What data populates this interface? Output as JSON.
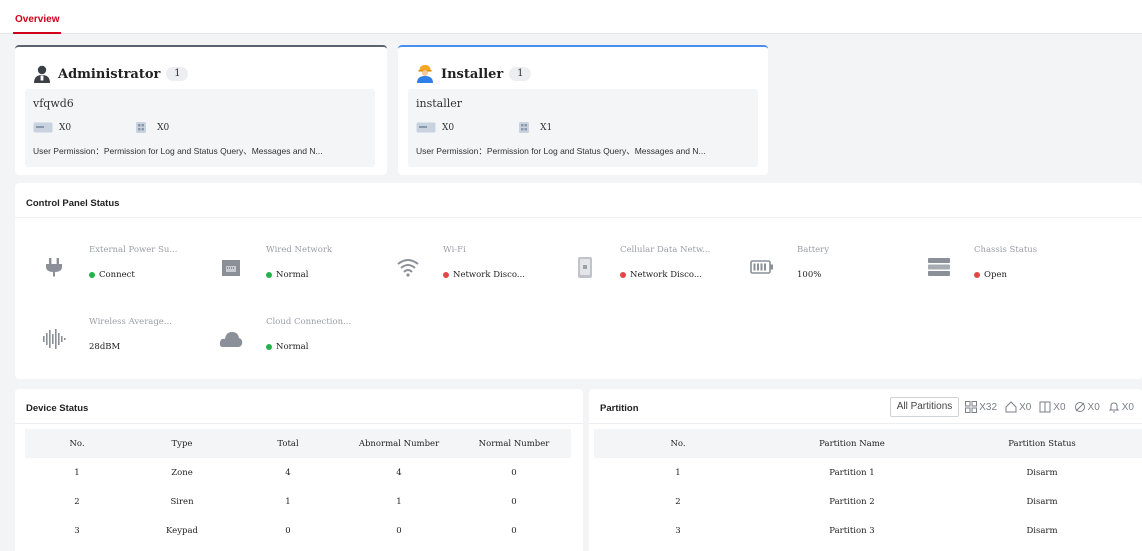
{
  "tabs": [
    {
      "label": "Overview",
      "active": true
    }
  ],
  "users": [
    {
      "role": "Administrator",
      "count": "1",
      "username": "vfqwd6",
      "card_count": "X0",
      "tag_count": "X0",
      "permission": "User Permission：Permission for Log and Status Query、Messages and N...",
      "icon": "admin-avatar-icon"
    },
    {
      "role": "Installer",
      "count": "1",
      "username": "installer",
      "card_count": "X0",
      "tag_count": "X1",
      "permission": "User Permission：Permission for Log and Status Query、Messages and N...",
      "icon": "installer-avatar-icon"
    }
  ],
  "control_panel": {
    "title": "Control Panel Status",
    "items": [
      {
        "label": "External Power Su...",
        "value": "Connect",
        "status_color": "#22b34a",
        "icon": "power-plug-icon"
      },
      {
        "label": "Wired Network",
        "value": "Normal",
        "status_color": "#22b34a",
        "icon": "wired-network-icon"
      },
      {
        "label": "Wi-Fi",
        "value": "Network Disco...",
        "status_color": "#e04848",
        "icon": "wifi-icon"
      },
      {
        "label": "Cellular Data Netw...",
        "value": "Network Disco...",
        "status_color": "#e04848",
        "icon": "sim-card-icon"
      },
      {
        "label": "Battery",
        "value": "100%",
        "status_color": "",
        "icon": "battery-icon"
      },
      {
        "label": "Chassis Status",
        "value": "Open",
        "status_color": "#e04848",
        "icon": "chassis-icon"
      },
      {
        "label": "Wireless Average...",
        "value": "28dBM",
        "status_color": "",
        "icon": "signal-wave-icon"
      },
      {
        "label": "Cloud Connection...",
        "value": "Normal",
        "status_color": "#22b34a",
        "icon": "cloud-icon"
      }
    ]
  },
  "device_status": {
    "title": "Device Status",
    "columns": [
      "No.",
      "Type",
      "Total",
      "Abnormal Number",
      "Normal Number"
    ],
    "rows": [
      [
        "1",
        "Zone",
        "4",
        "4",
        "0"
      ],
      [
        "2",
        "Siren",
        "1",
        "1",
        "0"
      ],
      [
        "3",
        "Keypad",
        "0",
        "0",
        "0"
      ]
    ]
  },
  "partition": {
    "title": "Partition",
    "filter": "All Partitions",
    "stats": [
      {
        "icon": "partition-grid-icon",
        "value": "X32"
      },
      {
        "icon": "away-arm-icon",
        "value": "X0"
      },
      {
        "icon": "stay-arm-icon",
        "value": "X0"
      },
      {
        "icon": "disarm-icon",
        "value": "X0"
      },
      {
        "icon": "alarm-bell-icon",
        "value": "X0"
      }
    ],
    "columns": [
      "No.",
      "Partition Name",
      "Partition Status"
    ],
    "rows": [
      [
        "1",
        "Partition 1",
        "Disarm"
      ],
      [
        "2",
        "Partition 2",
        "Disarm"
      ],
      [
        "3",
        "Partition 3",
        "Disarm"
      ]
    ]
  }
}
